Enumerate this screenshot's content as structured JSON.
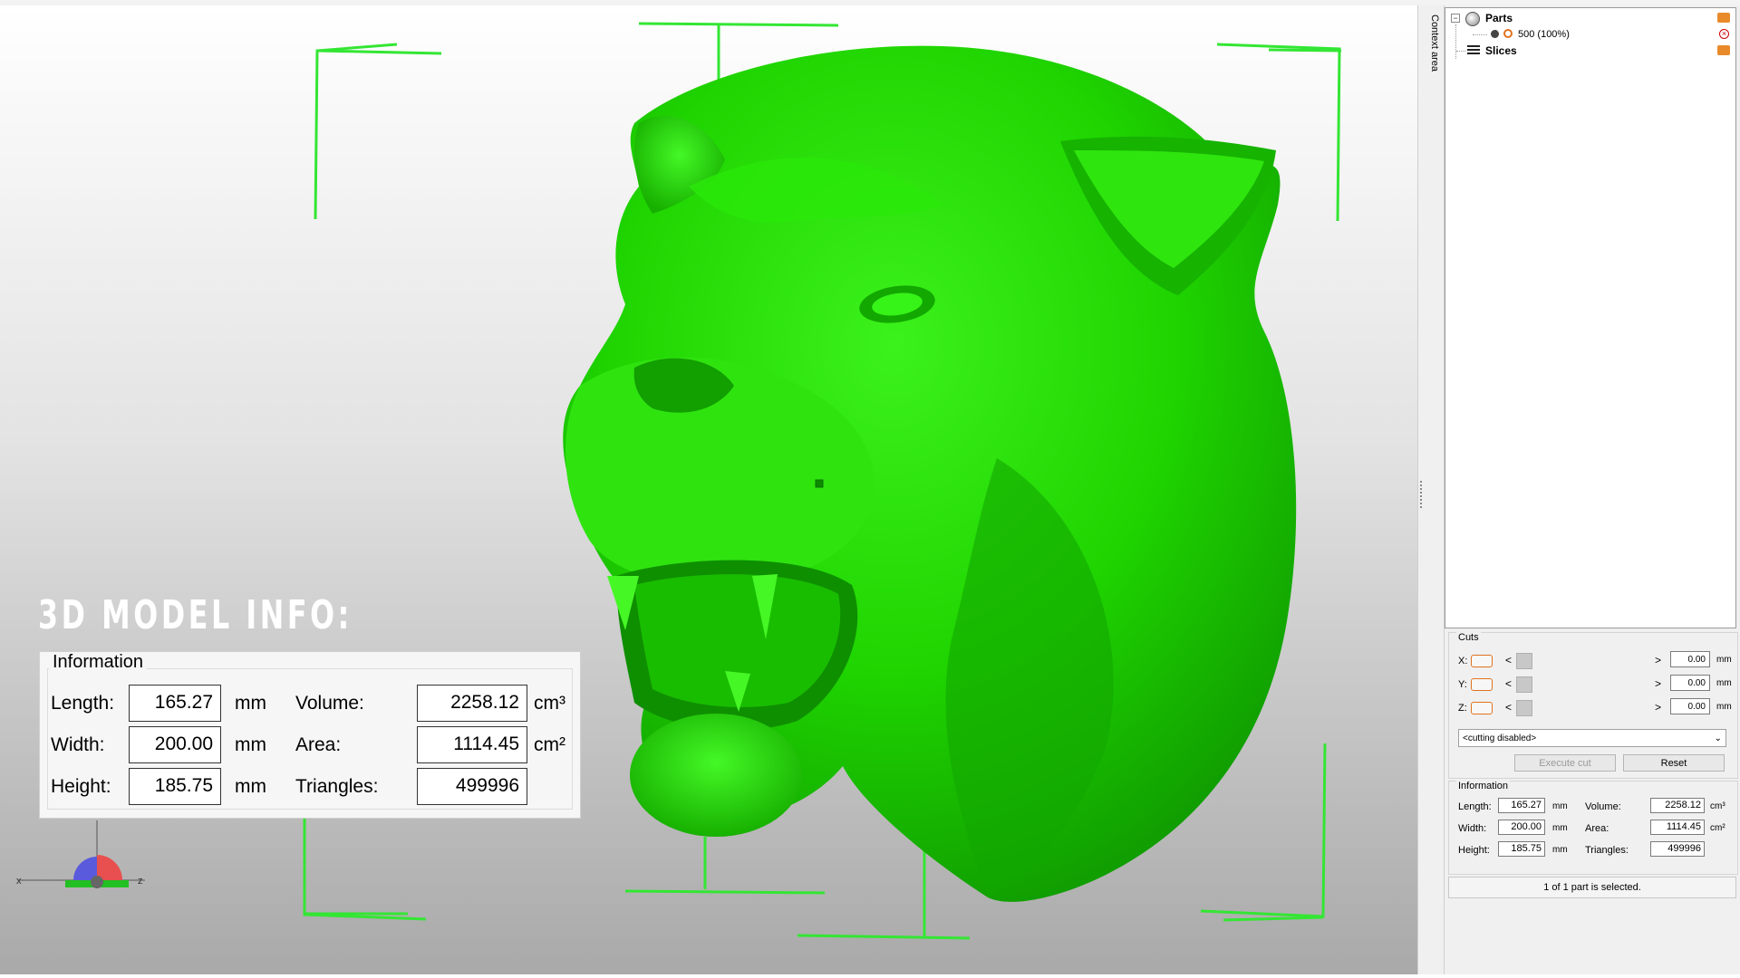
{
  "context_area": {
    "label": "Context area"
  },
  "tree": {
    "parts_label": "Parts",
    "part_item": "500 (100%)",
    "slices_label": "Slices"
  },
  "cuts": {
    "title": "Cuts",
    "rows": [
      {
        "axis": "X:",
        "value": "0.00",
        "unit": "mm"
      },
      {
        "axis": "Y:",
        "value": "0.00",
        "unit": "mm"
      },
      {
        "axis": "Z:",
        "value": "0.00",
        "unit": "mm"
      }
    ],
    "left_arrow": "<",
    "right_arrow": ">",
    "mode": "<cutting disabled>",
    "execute_label": "Execute cut",
    "reset_label": "Reset"
  },
  "information": {
    "title": "Information",
    "length_label": "Length:",
    "length": "165.27",
    "length_unit": "mm",
    "width_label": "Width:",
    "width": "200.00",
    "width_unit": "mm",
    "height_label": "Height:",
    "height": "185.75",
    "height_unit": "mm",
    "volume_label": "Volume:",
    "volume": "2258.12",
    "volume_unit": "cm³",
    "area_label": "Area:",
    "area": "1114.45",
    "area_unit": "cm²",
    "triangles_label": "Triangles:",
    "triangles": "499996"
  },
  "status": "1 of 1 part is selected.",
  "overlay": {
    "title": "3D MODEL INFO:"
  },
  "axes": {
    "x_label": "x",
    "z_label": "z"
  },
  "colors": {
    "model": "#1fd400",
    "bbox": "#33e633",
    "accent": "#e0731f"
  }
}
